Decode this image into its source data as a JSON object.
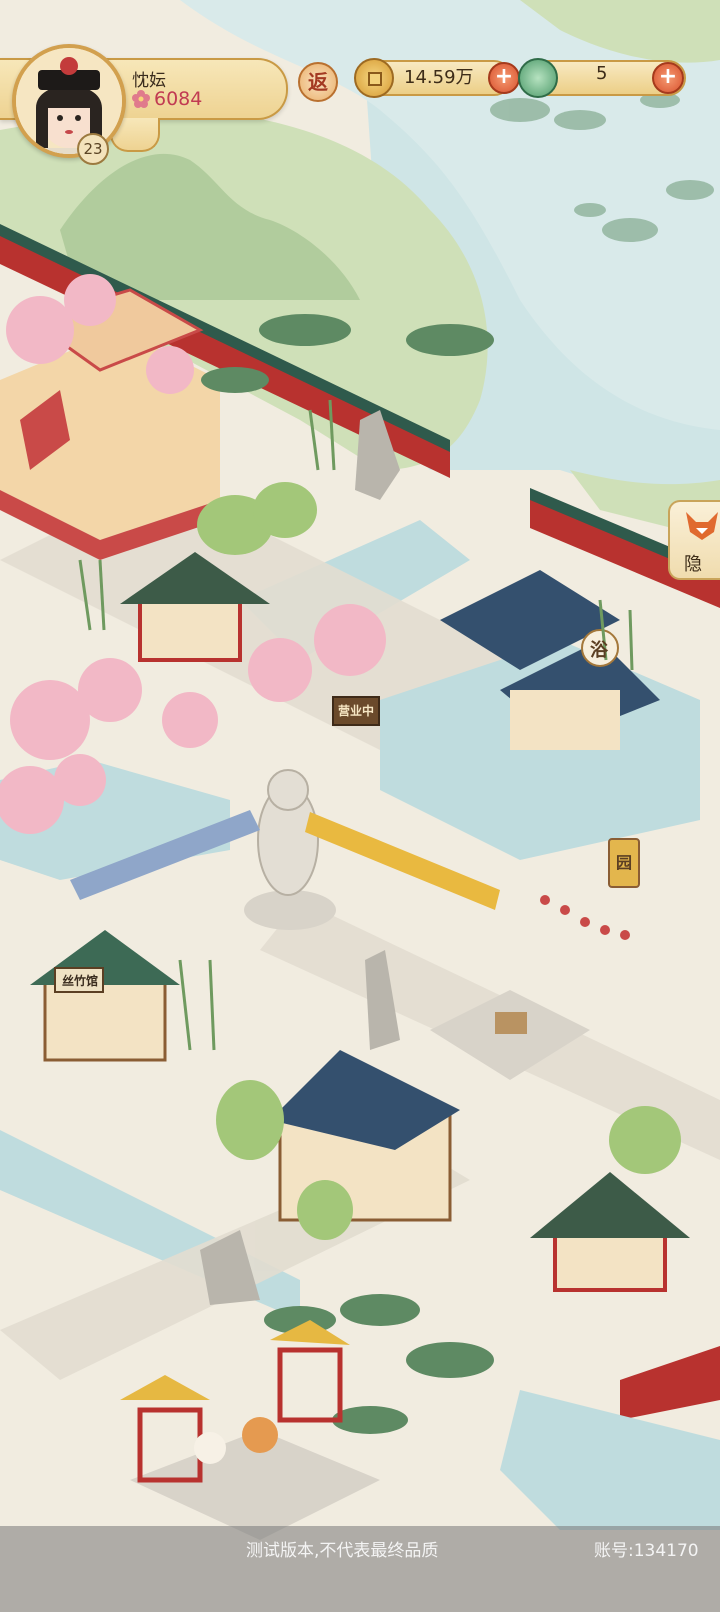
{
  "player": {
    "name": "忱妘",
    "popularity": "6084",
    "level": "23"
  },
  "hud": {
    "return_label": "返",
    "coins": "14.59万",
    "jade": "5",
    "plus_label": "+"
  },
  "side_tab": {
    "label": "隐"
  },
  "scene_signs": {
    "bathhouse_banner": "浴",
    "open_sign": "营业中",
    "garden_sign": "园",
    "music_hall_sign": "丝竹馆"
  },
  "footer": {
    "notice": "测试版本,不代表最终品质",
    "account": "账号:134170"
  },
  "colors": {
    "water": "#bfdcde",
    "ground": "#f1ece0",
    "wall_red": "#b8322f",
    "roof_blue": "#34506e",
    "roof_green": "#3d5b48",
    "blossom": "#f2b8c6"
  }
}
